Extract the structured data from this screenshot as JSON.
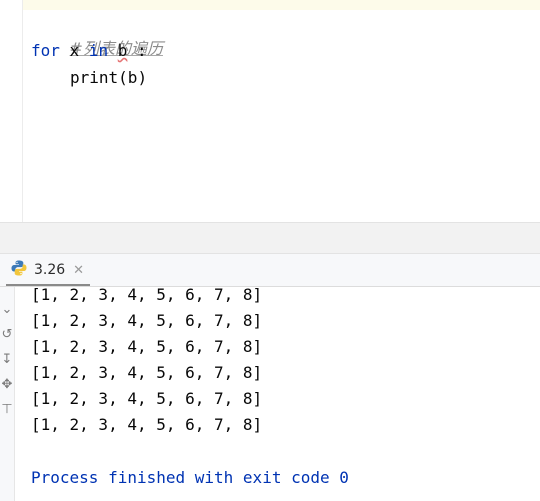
{
  "editor": {
    "comment": "#列表的遍历",
    "line2": {
      "kw_for": "for",
      "var": "x",
      "kw_in": "in",
      "iterable": "b",
      "colon": ":"
    },
    "line3": {
      "func": "print",
      "args": "(b)"
    }
  },
  "run": {
    "tab_label": "3.26",
    "tab_icon": "python-icon",
    "close_icon": "close-icon",
    "toolbar_icons": [
      "scroll-up-icon",
      "rerun-icon",
      "soft-wrap-icon",
      "pin-icon",
      "print-icon"
    ],
    "output_lines": [
      "[1, 2, 3, 4, 5, 6, 7, 8]",
      "[1, 2, 3, 4, 5, 6, 7, 8]",
      "[1, 2, 3, 4, 5, 6, 7, 8]",
      "[1, 2, 3, 4, 5, 6, 7, 8]",
      "[1, 2, 3, 4, 5, 6, 7, 8]",
      "[1, 2, 3, 4, 5, 6, 7, 8]"
    ],
    "process_message": "Process finished with exit code 0"
  },
  "colors": {
    "keyword": "#0033b3",
    "comment": "#8c8c8c",
    "text": "#080808"
  }
}
